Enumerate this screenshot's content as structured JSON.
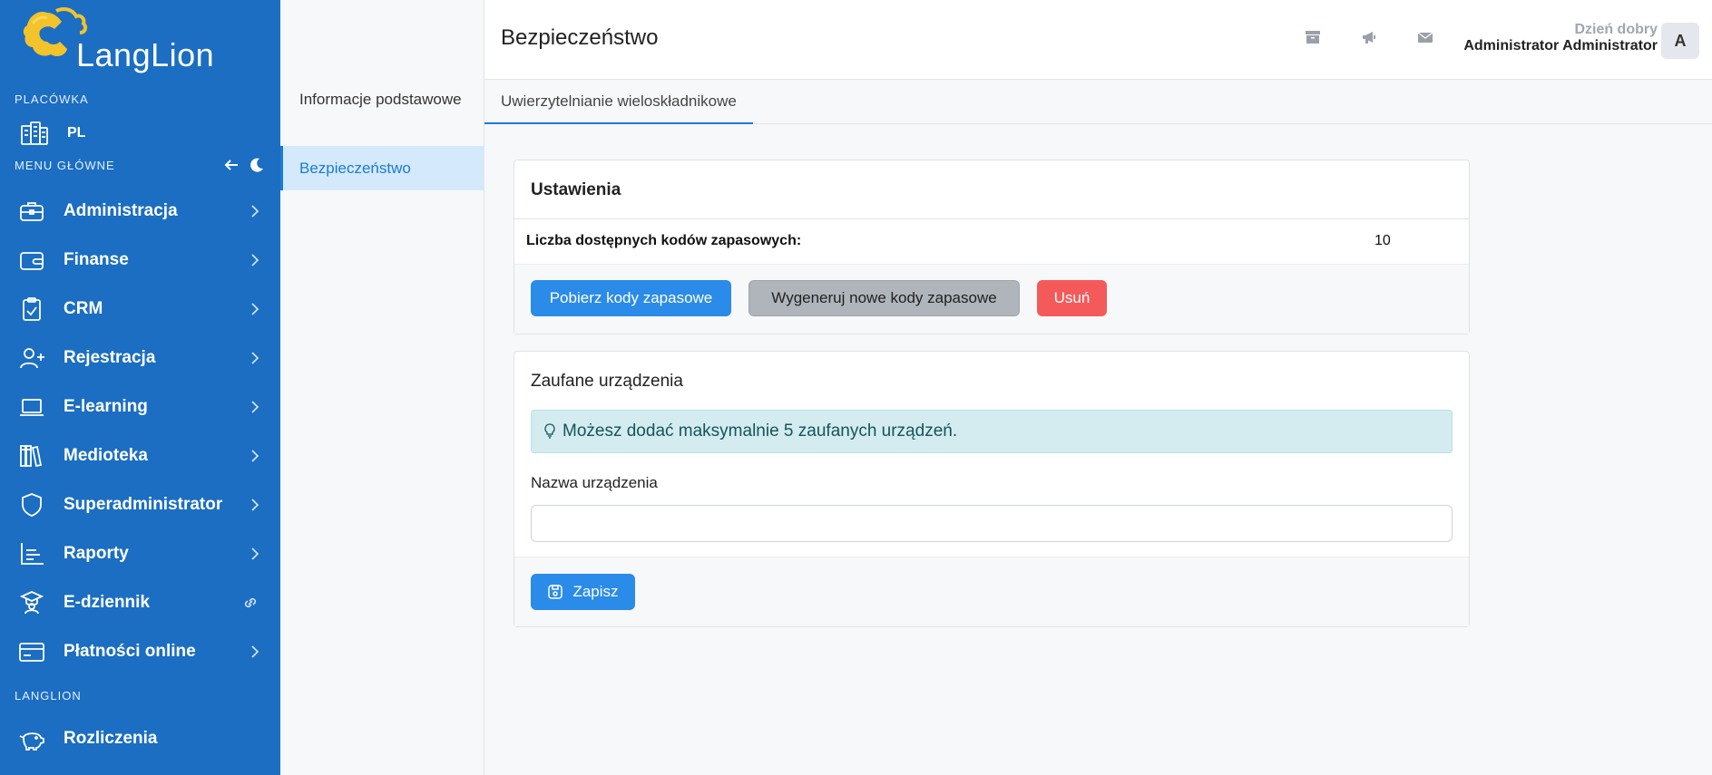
{
  "brand": {
    "name": "LangLion"
  },
  "sidebar": {
    "placowka_label": "PLACÓWKA",
    "placowka_value": "PL",
    "menu_label": "MENU GŁÓWNE",
    "langlion_label": "LANGLION",
    "items": [
      {
        "label": "Administracja",
        "icon": "briefcase-icon"
      },
      {
        "label": "Finanse",
        "icon": "wallet-icon"
      },
      {
        "label": "CRM",
        "icon": "clipboard-check-icon"
      },
      {
        "label": "Rejestracja",
        "icon": "user-plus-icon"
      },
      {
        "label": "E-learning",
        "icon": "laptop-icon"
      },
      {
        "label": "Medioteka",
        "icon": "library-icon"
      },
      {
        "label": "Superadministrator",
        "icon": "shield-icon"
      },
      {
        "label": "Raporty",
        "icon": "bar-chart-icon"
      },
      {
        "label": "E-dziennik",
        "icon": "graduate-icon"
      },
      {
        "label": "Płatności online",
        "icon": "credit-card-icon"
      }
    ],
    "langlion_items": [
      {
        "label": "Rozliczenia",
        "icon": "piggy-bank-icon"
      }
    ]
  },
  "subnav": {
    "items": [
      {
        "label": "Informacje podstawowe"
      },
      {
        "label": "Bezpieczeństwo"
      }
    ]
  },
  "header": {
    "title": "Bezpieczeństwo",
    "greeting": "Dzień dobry",
    "user_name": "Administrator Administrator",
    "avatar_letter": "A"
  },
  "tabs": [
    {
      "label": "Uwierzytelnianie wieloskładnikowe"
    }
  ],
  "settings": {
    "title": "Ustawienia",
    "backup_codes_label": "Liczba dostępnych kodów zapasowych:",
    "backup_codes_value": "10",
    "download_button": "Pobierz kody zapasowe",
    "regenerate_button": "Wygeneruj nowe kody zapasowe",
    "delete_button": "Usuń"
  },
  "devices": {
    "title": "Zaufane urządzenia",
    "info": "Możesz dodać maksymalnie 5 zaufanych urządzeń.",
    "field_label": "Nazwa urządzenia",
    "field_value": "",
    "save_button": "Zapisz"
  },
  "colors": {
    "sidebar": "#1b6ec2",
    "primary": "#2a8be8",
    "danger": "#f55a5a",
    "secondary": "#b0b4bb",
    "info_bg": "#d4ecef"
  }
}
